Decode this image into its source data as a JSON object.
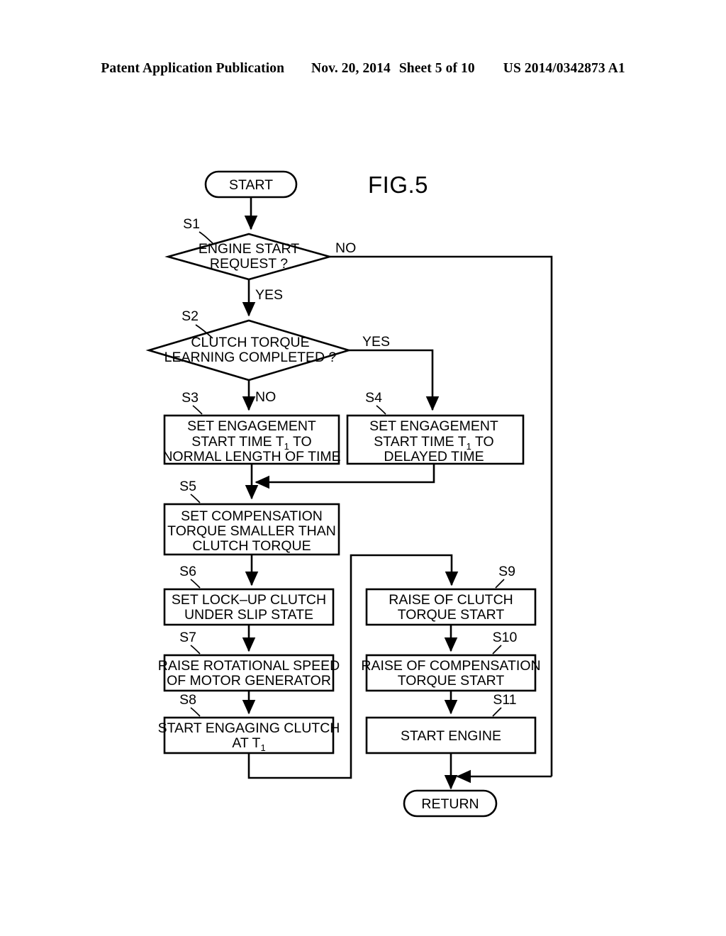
{
  "header": {
    "publication": "Patent Application Publication",
    "date": "Nov. 20, 2014",
    "sheet": "Sheet 5 of 10",
    "patent_number": "US 2014/0342873 A1"
  },
  "figure": {
    "title": "FIG.5",
    "type": "flowchart"
  },
  "terminals": {
    "start": "START",
    "return": "RETURN"
  },
  "nodes": [
    {
      "id": "S1",
      "step_label": "S1",
      "shape": "decision",
      "lines": [
        "ENGINE START",
        "REQUEST ?"
      ],
      "branches": {
        "right": "NO",
        "down": "YES"
      }
    },
    {
      "id": "S2",
      "step_label": "S2",
      "shape": "decision",
      "lines": [
        "CLUTCH TORQUE",
        "LEARNING COMPLETED ?"
      ],
      "branches": {
        "right": "YES",
        "down": "NO"
      }
    },
    {
      "id": "S3",
      "step_label": "S3",
      "shape": "process",
      "lines": [
        "SET ENGAGEMENT",
        "START TIME T|1| TO",
        "NORMAL LENGTH OF TIME"
      ]
    },
    {
      "id": "S4",
      "step_label": "S4",
      "shape": "process",
      "lines": [
        "SET ENGAGEMENT",
        "START TIME T|1| TO",
        "DELAYED TIME"
      ]
    },
    {
      "id": "S5",
      "step_label": "S5",
      "shape": "process",
      "lines": [
        "SET COMPENSATION",
        "TORQUE SMALLER THAN",
        "CLUTCH TORQUE"
      ]
    },
    {
      "id": "S6",
      "step_label": "S6",
      "shape": "process",
      "lines": [
        "SET LOCK–UP CLUTCH",
        "UNDER SLIP STATE"
      ]
    },
    {
      "id": "S7",
      "step_label": "S7",
      "shape": "process",
      "lines": [
        "RAISE ROTATIONAL SPEED",
        "OF MOTOR GENERATOR"
      ]
    },
    {
      "id": "S8",
      "step_label": "S8",
      "shape": "process",
      "lines": [
        "START ENGAGING CLUTCH",
        "AT T|1|"
      ]
    },
    {
      "id": "S9",
      "step_label": "S9",
      "shape": "process",
      "lines": [
        "RAISE OF CLUTCH",
        "TORQUE START"
      ]
    },
    {
      "id": "S10",
      "step_label": "S10",
      "shape": "process",
      "lines": [
        "RAISE OF COMPENSATION",
        "TORQUE START"
      ]
    },
    {
      "id": "S11",
      "step_label": "S11",
      "shape": "process",
      "lines": [
        "START ENGINE"
      ]
    }
  ],
  "node_text": {
    "s1_l1": "ENGINE START",
    "s1_l2": "REQUEST ?",
    "s1_label": "S1",
    "s1_no": "NO",
    "s1_yes": "YES",
    "s2_l1": "CLUTCH TORQUE",
    "s2_l2": "LEARNING COMPLETED ?",
    "s2_label": "S2",
    "s2_yes": "YES",
    "s2_no": "NO",
    "s3_label": "S3",
    "s3_l1": "SET ENGAGEMENT",
    "s3_l2a": "START TIME T",
    "s3_l2b": "1",
    "s3_l2c": " TO",
    "s3_l3": "NORMAL LENGTH OF TIME",
    "s4_label": "S4",
    "s4_l1": "SET ENGAGEMENT",
    "s4_l2a": "START TIME T",
    "s4_l2b": "1",
    "s4_l2c": " TO",
    "s4_l3": "DELAYED TIME",
    "s5_label": "S5",
    "s5_l1": "SET COMPENSATION",
    "s5_l2": "TORQUE SMALLER THAN",
    "s5_l3": "CLUTCH TORQUE",
    "s6_label": "S6",
    "s6_l1": "SET LOCK–UP CLUTCH",
    "s6_l2": "UNDER SLIP STATE",
    "s7_label": "S7",
    "s7_l1": "RAISE ROTATIONAL SPEED",
    "s7_l2": "OF MOTOR GENERATOR",
    "s8_label": "S8",
    "s8_l1": "START ENGAGING CLUTCH",
    "s8_l2a": "AT T",
    "s8_l2b": "1",
    "s9_label": "S9",
    "s9_l1": "RAISE OF CLUTCH",
    "s9_l2": "TORQUE START",
    "s10_label": "S10",
    "s10_l1": "RAISE OF COMPENSATION",
    "s10_l2": "TORQUE START",
    "s11_label": "S11",
    "s11_l1": "START ENGINE"
  },
  "colors": {
    "ink": "#000000",
    "paper": "#ffffff"
  }
}
